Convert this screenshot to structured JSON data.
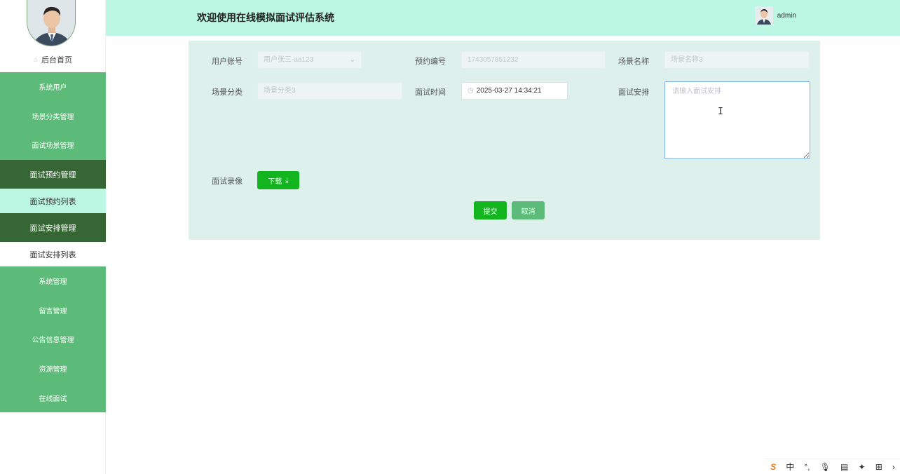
{
  "sidebar": {
    "home_label": "后台首页",
    "items": [
      {
        "label": "系统用户"
      },
      {
        "label": "场景分类管理"
      },
      {
        "label": "面试场景管理"
      },
      {
        "label": "面试预约管理"
      },
      {
        "label": "面试预约列表"
      },
      {
        "label": "面试安排管理"
      },
      {
        "label": "面试安排列表"
      },
      {
        "label": "系统管理"
      },
      {
        "label": "留言管理"
      },
      {
        "label": "公告信息管理"
      },
      {
        "label": "资源管理"
      },
      {
        "label": "在线面试"
      }
    ]
  },
  "header": {
    "title": "欢迎使用在线模拟面试评估系统",
    "username": "admin"
  },
  "form": {
    "user_account": {
      "label": "用户账号",
      "value": "用户张三-aa123"
    },
    "booking_no": {
      "label": "预约编号",
      "value": "1743057851232"
    },
    "scene_name": {
      "label": "场景名称",
      "value": "场景名称3"
    },
    "scene_category": {
      "label": "场景分类",
      "value": "场景分类3"
    },
    "interview_time": {
      "label": "面试时间",
      "value": "2025-03-27 14:34:21"
    },
    "arrangement": {
      "label": "面试安排",
      "placeholder": "请输入面试安排"
    },
    "recording": {
      "label": "面试录像",
      "download_label": "下载"
    },
    "submit_label": "提交",
    "cancel_label": "取消"
  },
  "tray": {
    "ime_label": "中"
  },
  "colors": {
    "header_bg": "#bbf7e2",
    "menu_green": "#5cbb78",
    "menu_dark": "#366634",
    "panel_bg": "#ddf0eb",
    "button_green": "#13b51f"
  }
}
